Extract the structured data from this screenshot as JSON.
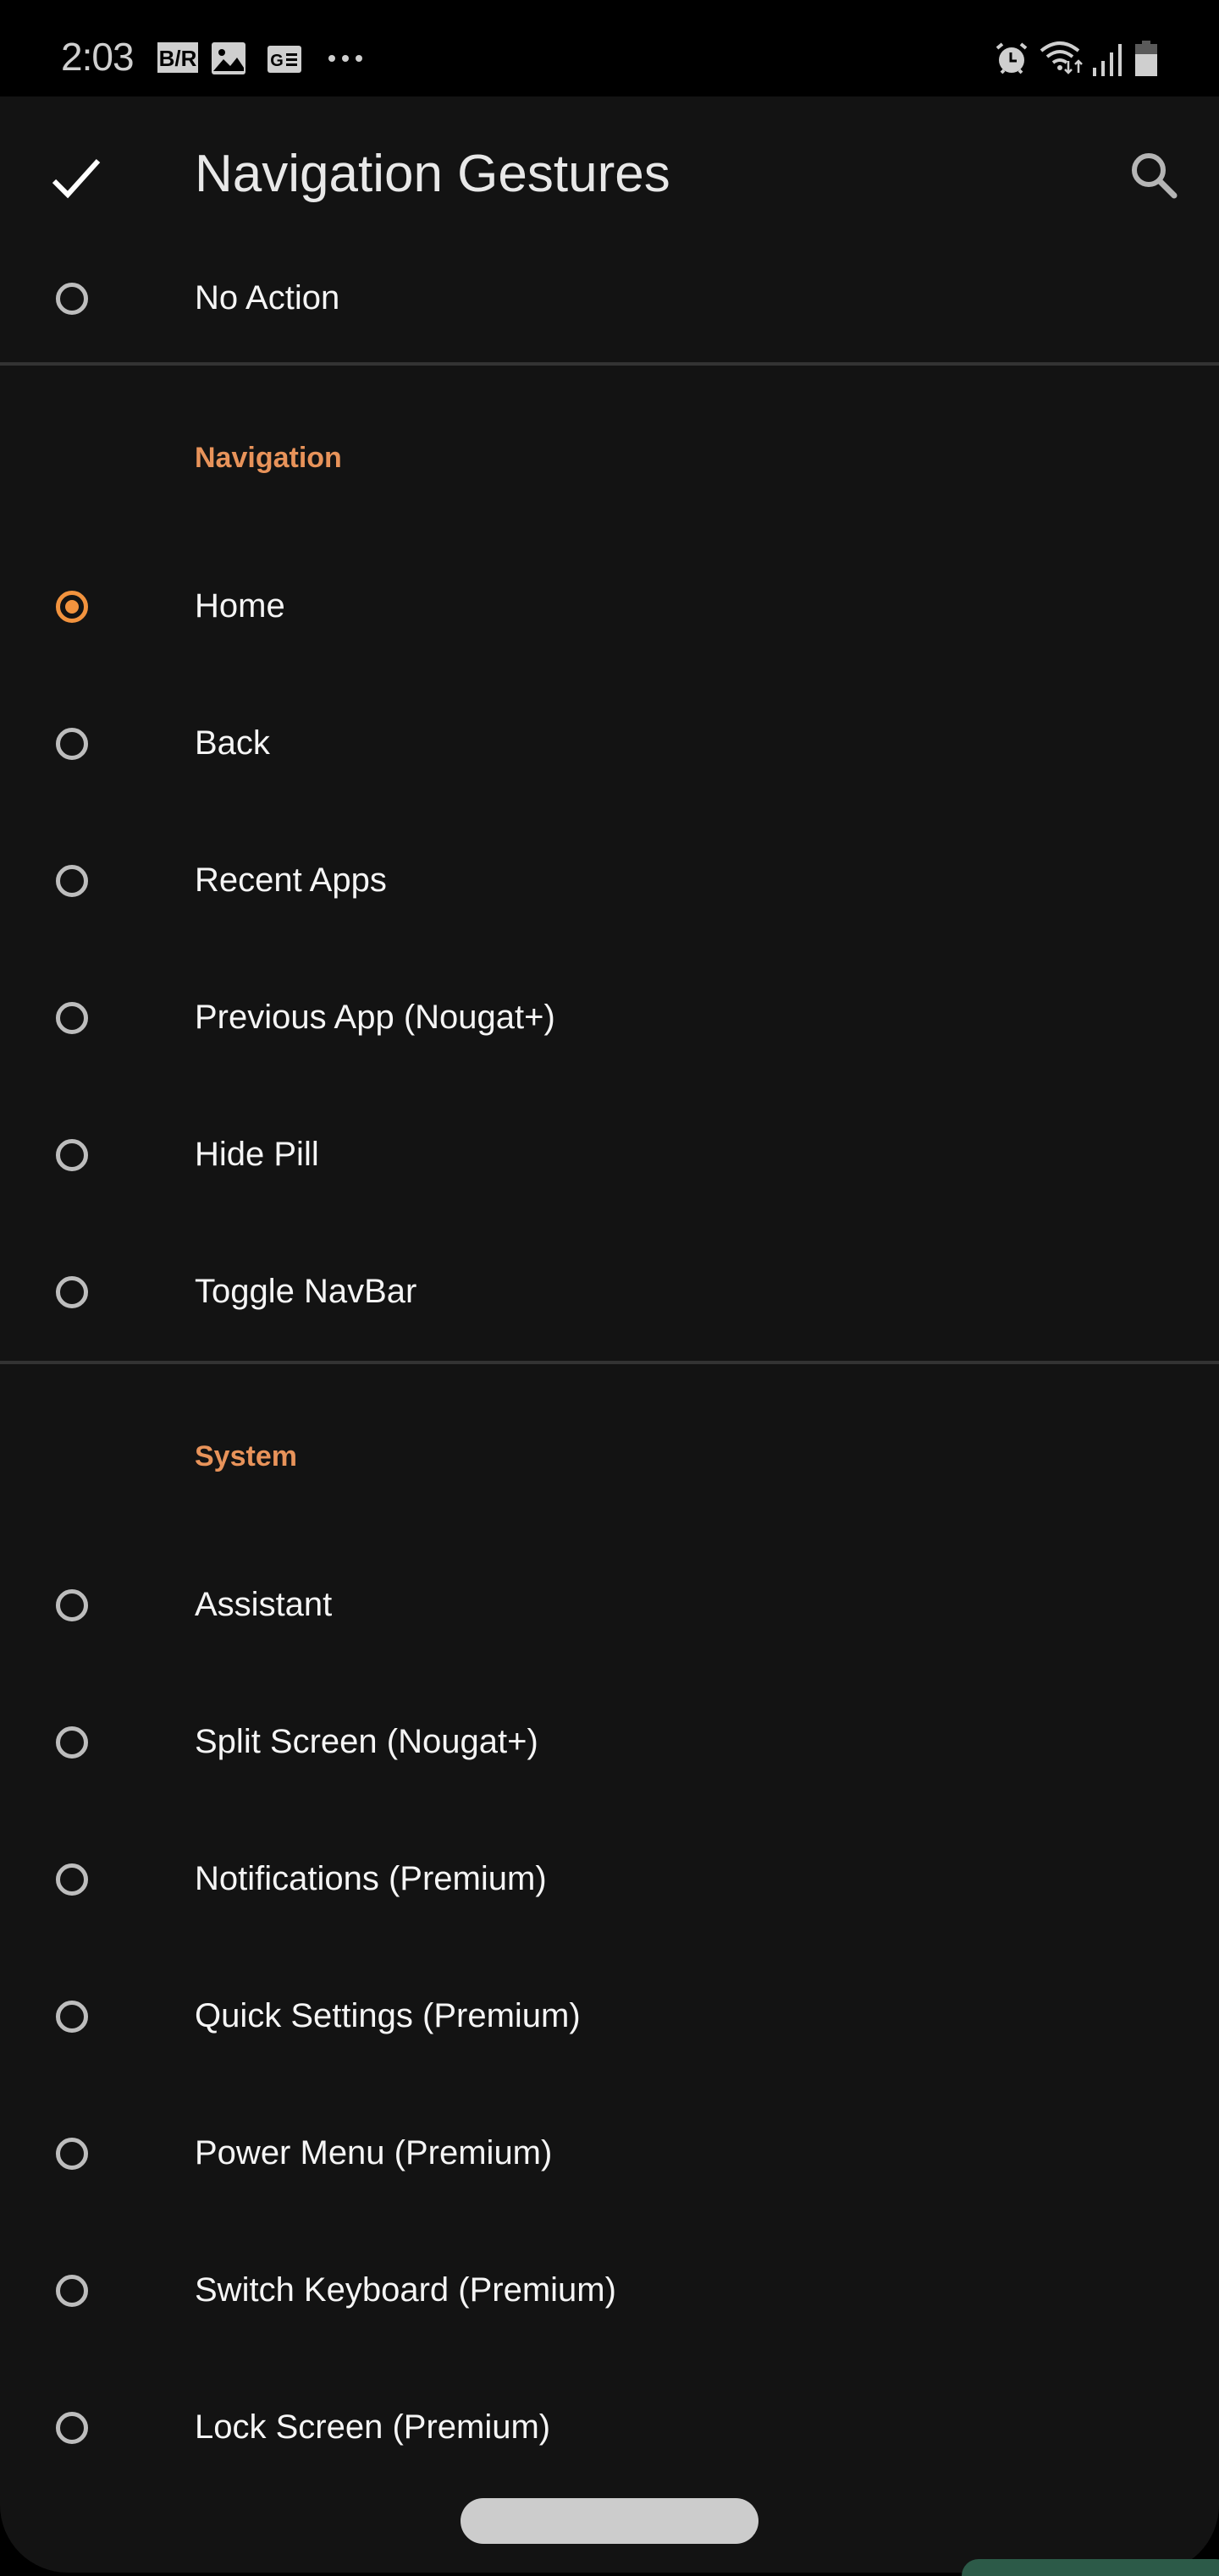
{
  "status_bar": {
    "time": "2:03",
    "left_icons": [
      "bleacher-report-icon",
      "gallery-icon",
      "news-icon",
      "more-notifications-icon"
    ],
    "right_icons": [
      "alarm-icon",
      "wifi-icon",
      "signal-icon",
      "battery-icon"
    ]
  },
  "toolbar": {
    "title": "Navigation Gestures",
    "confirm_icon": "check-icon",
    "search_icon": "search-icon"
  },
  "accent_color": "#f2933e",
  "top_items": [
    {
      "label": "No Action",
      "selected": false
    }
  ],
  "sections": [
    {
      "header": "Navigation",
      "items": [
        {
          "label": "Home",
          "selected": true
        },
        {
          "label": "Back",
          "selected": false
        },
        {
          "label": "Recent Apps",
          "selected": false
        },
        {
          "label": "Previous App (Nougat+)",
          "selected": false
        },
        {
          "label": "Hide Pill",
          "selected": false
        },
        {
          "label": "Toggle NavBar",
          "selected": false
        }
      ]
    },
    {
      "header": "System",
      "items": [
        {
          "label": "Assistant",
          "selected": false
        },
        {
          "label": "Split Screen (Nougat+)",
          "selected": false
        },
        {
          "label": "Notifications (Premium)",
          "selected": false
        },
        {
          "label": "Quick Settings (Premium)",
          "selected": false
        },
        {
          "label": "Power Menu (Premium)",
          "selected": false
        },
        {
          "label": "Switch Keyboard (Premium)",
          "selected": false
        },
        {
          "label": "Lock Screen (Premium)",
          "selected": false
        }
      ]
    }
  ]
}
